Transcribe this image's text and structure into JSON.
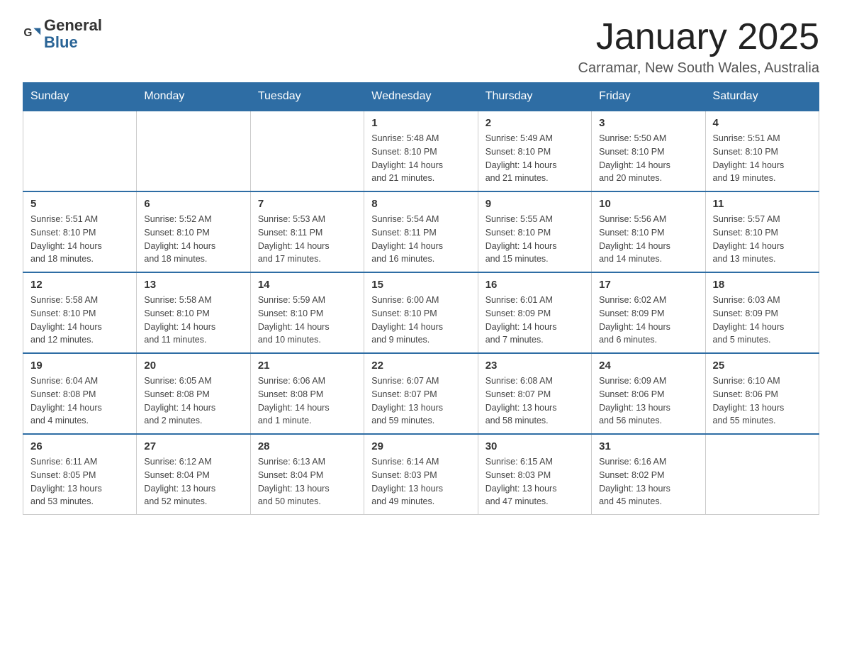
{
  "logo": {
    "text_general": "General",
    "text_blue": "Blue",
    "icon_alt": "GeneralBlue logo"
  },
  "header": {
    "month_title": "January 2025",
    "location": "Carramar, New South Wales, Australia"
  },
  "days_of_week": [
    "Sunday",
    "Monday",
    "Tuesday",
    "Wednesday",
    "Thursday",
    "Friday",
    "Saturday"
  ],
  "weeks": [
    [
      {
        "day": "",
        "info": ""
      },
      {
        "day": "",
        "info": ""
      },
      {
        "day": "",
        "info": ""
      },
      {
        "day": "1",
        "info": "Sunrise: 5:48 AM\nSunset: 8:10 PM\nDaylight: 14 hours\nand 21 minutes."
      },
      {
        "day": "2",
        "info": "Sunrise: 5:49 AM\nSunset: 8:10 PM\nDaylight: 14 hours\nand 21 minutes."
      },
      {
        "day": "3",
        "info": "Sunrise: 5:50 AM\nSunset: 8:10 PM\nDaylight: 14 hours\nand 20 minutes."
      },
      {
        "day": "4",
        "info": "Sunrise: 5:51 AM\nSunset: 8:10 PM\nDaylight: 14 hours\nand 19 minutes."
      }
    ],
    [
      {
        "day": "5",
        "info": "Sunrise: 5:51 AM\nSunset: 8:10 PM\nDaylight: 14 hours\nand 18 minutes."
      },
      {
        "day": "6",
        "info": "Sunrise: 5:52 AM\nSunset: 8:10 PM\nDaylight: 14 hours\nand 18 minutes."
      },
      {
        "day": "7",
        "info": "Sunrise: 5:53 AM\nSunset: 8:11 PM\nDaylight: 14 hours\nand 17 minutes."
      },
      {
        "day": "8",
        "info": "Sunrise: 5:54 AM\nSunset: 8:11 PM\nDaylight: 14 hours\nand 16 minutes."
      },
      {
        "day": "9",
        "info": "Sunrise: 5:55 AM\nSunset: 8:10 PM\nDaylight: 14 hours\nand 15 minutes."
      },
      {
        "day": "10",
        "info": "Sunrise: 5:56 AM\nSunset: 8:10 PM\nDaylight: 14 hours\nand 14 minutes."
      },
      {
        "day": "11",
        "info": "Sunrise: 5:57 AM\nSunset: 8:10 PM\nDaylight: 14 hours\nand 13 minutes."
      }
    ],
    [
      {
        "day": "12",
        "info": "Sunrise: 5:58 AM\nSunset: 8:10 PM\nDaylight: 14 hours\nand 12 minutes."
      },
      {
        "day": "13",
        "info": "Sunrise: 5:58 AM\nSunset: 8:10 PM\nDaylight: 14 hours\nand 11 minutes."
      },
      {
        "day": "14",
        "info": "Sunrise: 5:59 AM\nSunset: 8:10 PM\nDaylight: 14 hours\nand 10 minutes."
      },
      {
        "day": "15",
        "info": "Sunrise: 6:00 AM\nSunset: 8:10 PM\nDaylight: 14 hours\nand 9 minutes."
      },
      {
        "day": "16",
        "info": "Sunrise: 6:01 AM\nSunset: 8:09 PM\nDaylight: 14 hours\nand 7 minutes."
      },
      {
        "day": "17",
        "info": "Sunrise: 6:02 AM\nSunset: 8:09 PM\nDaylight: 14 hours\nand 6 minutes."
      },
      {
        "day": "18",
        "info": "Sunrise: 6:03 AM\nSunset: 8:09 PM\nDaylight: 14 hours\nand 5 minutes."
      }
    ],
    [
      {
        "day": "19",
        "info": "Sunrise: 6:04 AM\nSunset: 8:08 PM\nDaylight: 14 hours\nand 4 minutes."
      },
      {
        "day": "20",
        "info": "Sunrise: 6:05 AM\nSunset: 8:08 PM\nDaylight: 14 hours\nand 2 minutes."
      },
      {
        "day": "21",
        "info": "Sunrise: 6:06 AM\nSunset: 8:08 PM\nDaylight: 14 hours\nand 1 minute."
      },
      {
        "day": "22",
        "info": "Sunrise: 6:07 AM\nSunset: 8:07 PM\nDaylight: 13 hours\nand 59 minutes."
      },
      {
        "day": "23",
        "info": "Sunrise: 6:08 AM\nSunset: 8:07 PM\nDaylight: 13 hours\nand 58 minutes."
      },
      {
        "day": "24",
        "info": "Sunrise: 6:09 AM\nSunset: 8:06 PM\nDaylight: 13 hours\nand 56 minutes."
      },
      {
        "day": "25",
        "info": "Sunrise: 6:10 AM\nSunset: 8:06 PM\nDaylight: 13 hours\nand 55 minutes."
      }
    ],
    [
      {
        "day": "26",
        "info": "Sunrise: 6:11 AM\nSunset: 8:05 PM\nDaylight: 13 hours\nand 53 minutes."
      },
      {
        "day": "27",
        "info": "Sunrise: 6:12 AM\nSunset: 8:04 PM\nDaylight: 13 hours\nand 52 minutes."
      },
      {
        "day": "28",
        "info": "Sunrise: 6:13 AM\nSunset: 8:04 PM\nDaylight: 13 hours\nand 50 minutes."
      },
      {
        "day": "29",
        "info": "Sunrise: 6:14 AM\nSunset: 8:03 PM\nDaylight: 13 hours\nand 49 minutes."
      },
      {
        "day": "30",
        "info": "Sunrise: 6:15 AM\nSunset: 8:03 PM\nDaylight: 13 hours\nand 47 minutes."
      },
      {
        "day": "31",
        "info": "Sunrise: 6:16 AM\nSunset: 8:02 PM\nDaylight: 13 hours\nand 45 minutes."
      },
      {
        "day": "",
        "info": ""
      }
    ]
  ]
}
